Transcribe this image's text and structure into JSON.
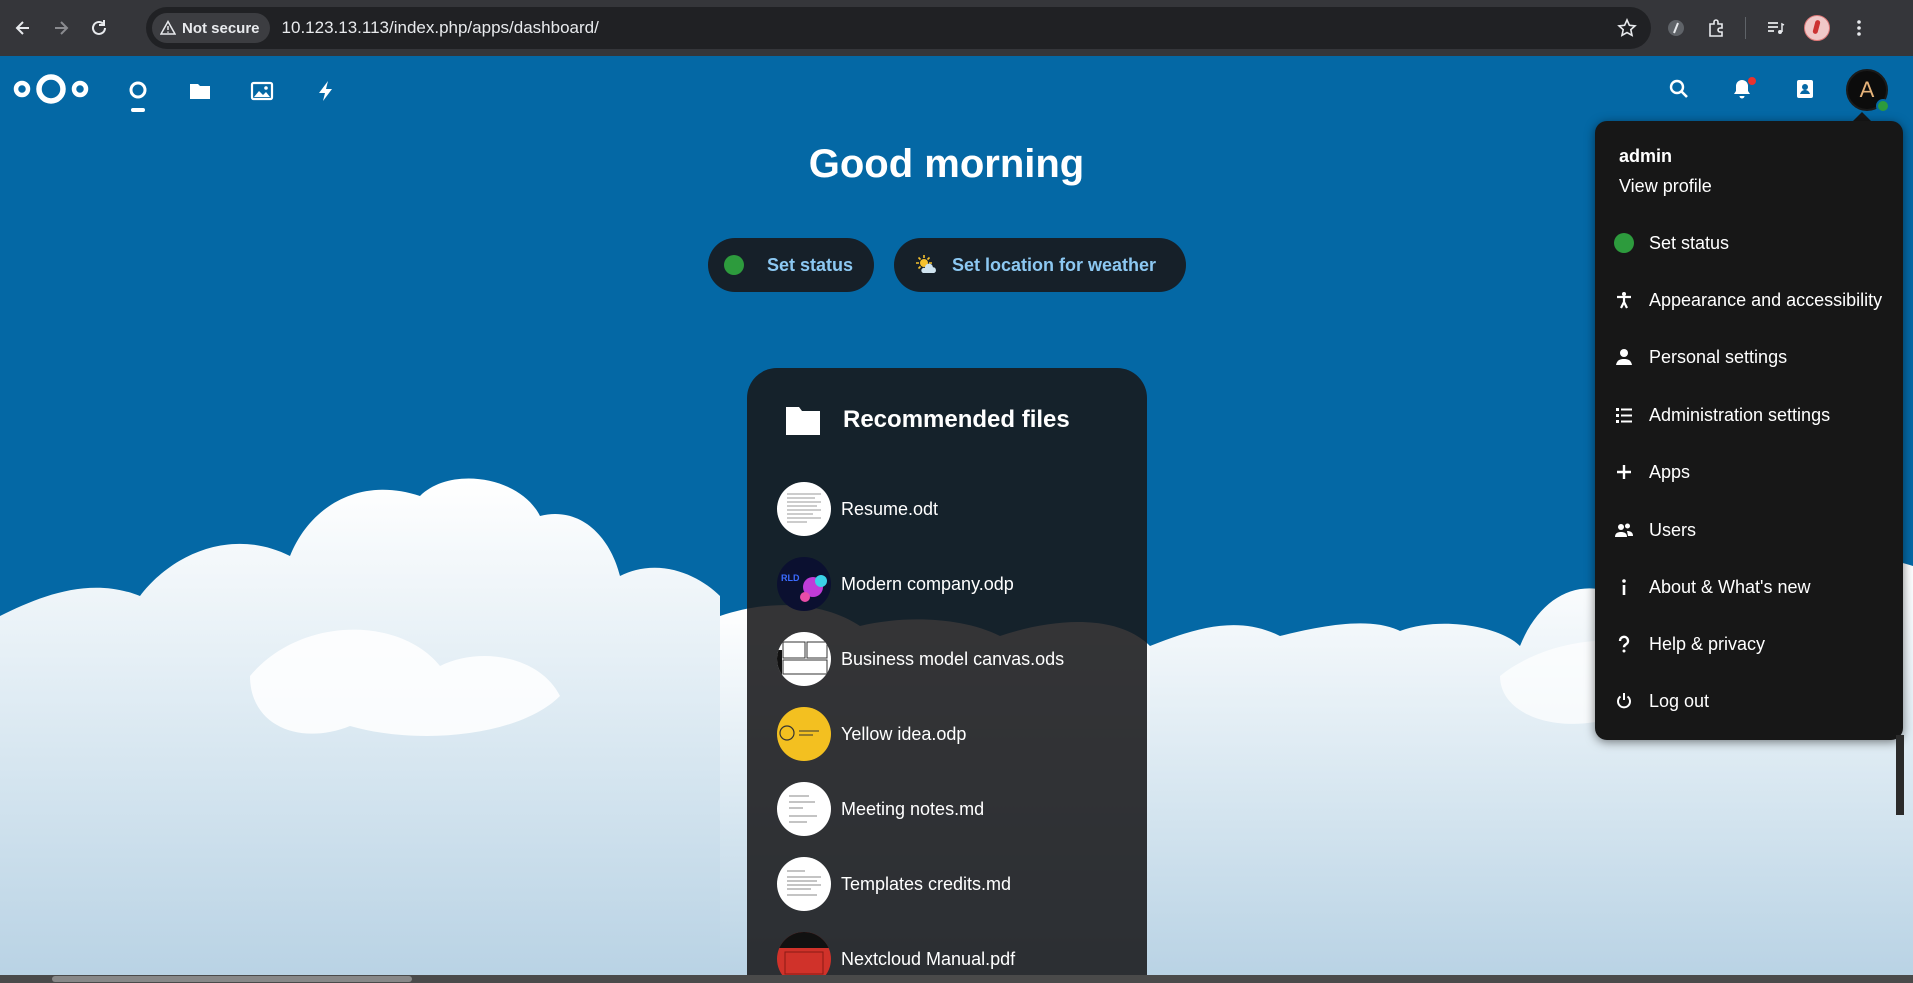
{
  "browser": {
    "security_label": "Not secure",
    "url": "10.123.13.113/index.php/apps/dashboard/"
  },
  "header": {
    "apps": [
      {
        "name": "dashboard",
        "icon": "dashboard-icon"
      },
      {
        "name": "files",
        "icon": "folder-icon"
      },
      {
        "name": "photos",
        "icon": "image-icon"
      },
      {
        "name": "activity",
        "icon": "lightning-icon"
      }
    ],
    "avatar_letter": "A"
  },
  "dashboard": {
    "greeting": "Good morning",
    "set_status_label": "Set status",
    "weather_label": "Set location for weather"
  },
  "widget": {
    "title": "Recommended files",
    "files": [
      {
        "name": "Resume.odt"
      },
      {
        "name": "Modern company.odp"
      },
      {
        "name": "Business model canvas.ods"
      },
      {
        "name": "Yellow idea.odp"
      },
      {
        "name": "Meeting notes.md"
      },
      {
        "name": "Templates credits.md"
      },
      {
        "name": "Nextcloud Manual.pdf"
      }
    ]
  },
  "menu": {
    "username": "admin",
    "view_profile": "View profile",
    "items": [
      {
        "label": "Set status",
        "icon": "status-dot-icon"
      },
      {
        "label": "Appearance and accessibility",
        "icon": "accessibility-icon"
      },
      {
        "label": "Personal settings",
        "icon": "person-icon"
      },
      {
        "label": "Administration settings",
        "icon": "list-icon"
      },
      {
        "label": "Apps",
        "icon": "plus-icon"
      },
      {
        "label": "Users",
        "icon": "users-icon"
      },
      {
        "label": "About & What's new",
        "icon": "info-icon"
      },
      {
        "label": "Help & privacy",
        "icon": "question-icon"
      },
      {
        "label": "Log out",
        "icon": "power-icon"
      }
    ]
  },
  "colors": {
    "nextcloud_blue": "#0468a5",
    "status_green": "#2d9b3d",
    "link_blue": "#8cc8f2"
  }
}
